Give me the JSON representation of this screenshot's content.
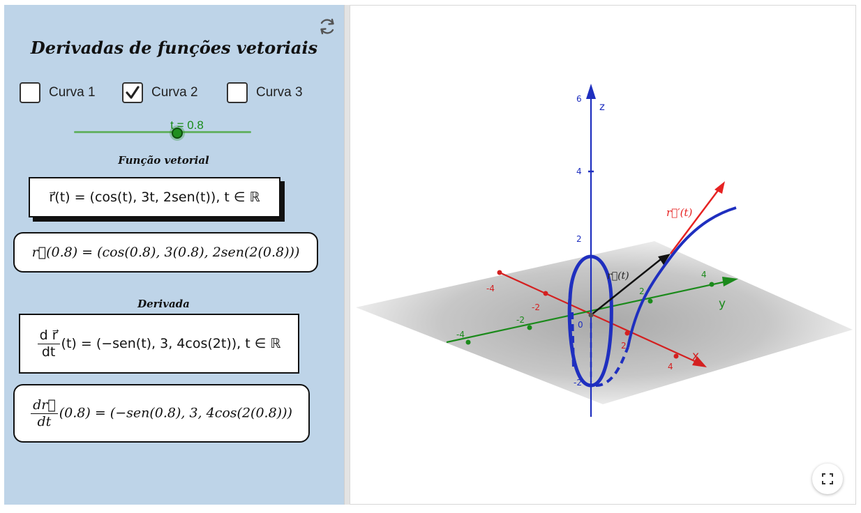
{
  "panel": {
    "title": "Derivadas de funções vetoriais",
    "checkboxes": [
      {
        "label": "Curva 1",
        "checked": false
      },
      {
        "label": "Curva 2",
        "checked": true
      },
      {
        "label": "Curva 3",
        "checked": false
      }
    ],
    "slider": {
      "label": "t = 0.8",
      "value": 0.8
    },
    "section_function": "Função vetorial",
    "function_def": "r⃗(t) = (cos(t), 3t, 2sen(t)), t ∈ ℝ",
    "function_eval": "r⃗(0.8) = (cos(0.8), 3(0.8), 2sen(2(0.8)))",
    "section_derivative": "Derivada",
    "derivative_num": "d r⃗",
    "derivative_den": "dt",
    "derivative_def": "(t) = (−sen(t), 3, 4cos(2t)), t ∈ ℝ",
    "derivative_eval_num": "dr⃗",
    "derivative_eval_den": "dt",
    "derivative_eval": "(0.8) = (−sen(0.8), 3, 4cos(2(0.8)))"
  },
  "graphics": {
    "z_axis_label": "z",
    "y_axis_label": "y",
    "x_axis_label": "x",
    "z_ticks": [
      "6",
      "4",
      "2",
      "0",
      "-2"
    ],
    "y_ticks": [
      "-4",
      "-2",
      "2",
      "4"
    ],
    "x_ticks": [
      "-4",
      "-2",
      "2",
      "4"
    ],
    "derivative_vector_label": "r⃗′(t)",
    "position_vector_label": "r⃗(t)"
  },
  "colors": {
    "panel_bg": "#bed4e8",
    "curve": "#1f2fbf",
    "x_axis": "#d42020",
    "y_axis": "#1b8a1b",
    "z_axis": "#1f2fbf",
    "slider": "#1f8f1f",
    "derivative_vector": "#e62222",
    "position_vector": "#111111"
  },
  "icons": {
    "reset": "refresh-icon",
    "fullscreen": "fullscreen-icon",
    "checkmark": "checkmark-icon"
  }
}
